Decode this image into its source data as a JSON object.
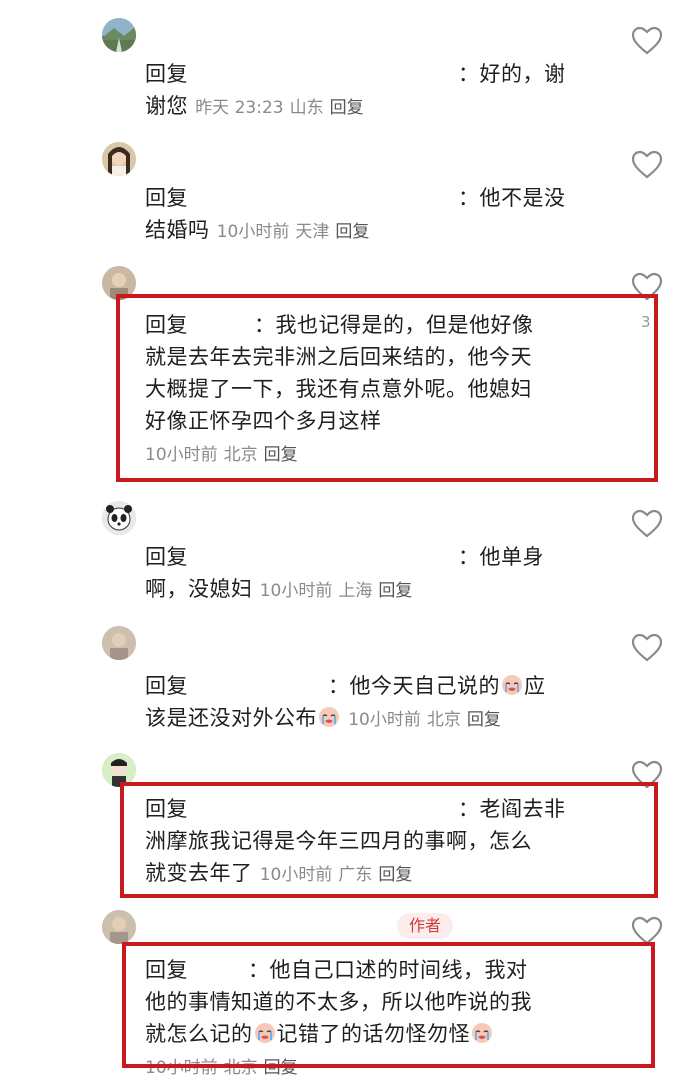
{
  "colors": {
    "highlight": "#c8191e",
    "meta": "#8a8a8a",
    "heart": "#8a8a8a"
  },
  "comments": [
    {
      "id": "c1",
      "prefix": "回复",
      "body_lines": [
        "：好的，谢",
        "谢您"
      ],
      "time": "昨天 23:23",
      "location": "山东",
      "reply": "回复"
    },
    {
      "id": "c2",
      "prefix": "回复",
      "body_lines": [
        "：他不是没",
        "结婚吗"
      ],
      "time": "10小时前",
      "location": "天津",
      "reply": "回复"
    },
    {
      "id": "c3",
      "prefix": "回复",
      "body_lines": [
        "：我也记得是的，但是他好像",
        "就是去年去完非洲之后回来结的，他今天",
        "大概提了一下，我还有点意外呢。他媳妇",
        "好像正怀孕四个多月这样"
      ],
      "time": "10小时前",
      "location": "北京",
      "reply": "回复",
      "like_count": "3"
    },
    {
      "id": "c4",
      "prefix": "回复",
      "body_lines": [
        "：他单身",
        "啊，没媳妇"
      ],
      "time": "10小时前",
      "location": "上海",
      "reply": "回复"
    },
    {
      "id": "c5",
      "prefix": "回复",
      "body_lines": [
        "：他今天自己说的",
        "应",
        "该是还没对外公布"
      ],
      "time": "10小时前",
      "location": "北京",
      "reply": "回复"
    },
    {
      "id": "c6",
      "prefix": "回复",
      "body_lines": [
        "：老阎去非",
        "洲摩旅我记得是今年三四月的事啊，怎么",
        "就变去年了"
      ],
      "time": "10小时前",
      "location": "广东",
      "reply": "回复"
    },
    {
      "id": "c7",
      "badge": "作者",
      "prefix": "回复",
      "body_lines": [
        "：他自己口述的时间线，我对",
        "他的事情知道的不太多，所以他咋说的我",
        "就怎么记的",
        "记错了的话勿怪勿怪"
      ],
      "time": "10小时前",
      "location": "北京",
      "reply": "回复"
    }
  ]
}
